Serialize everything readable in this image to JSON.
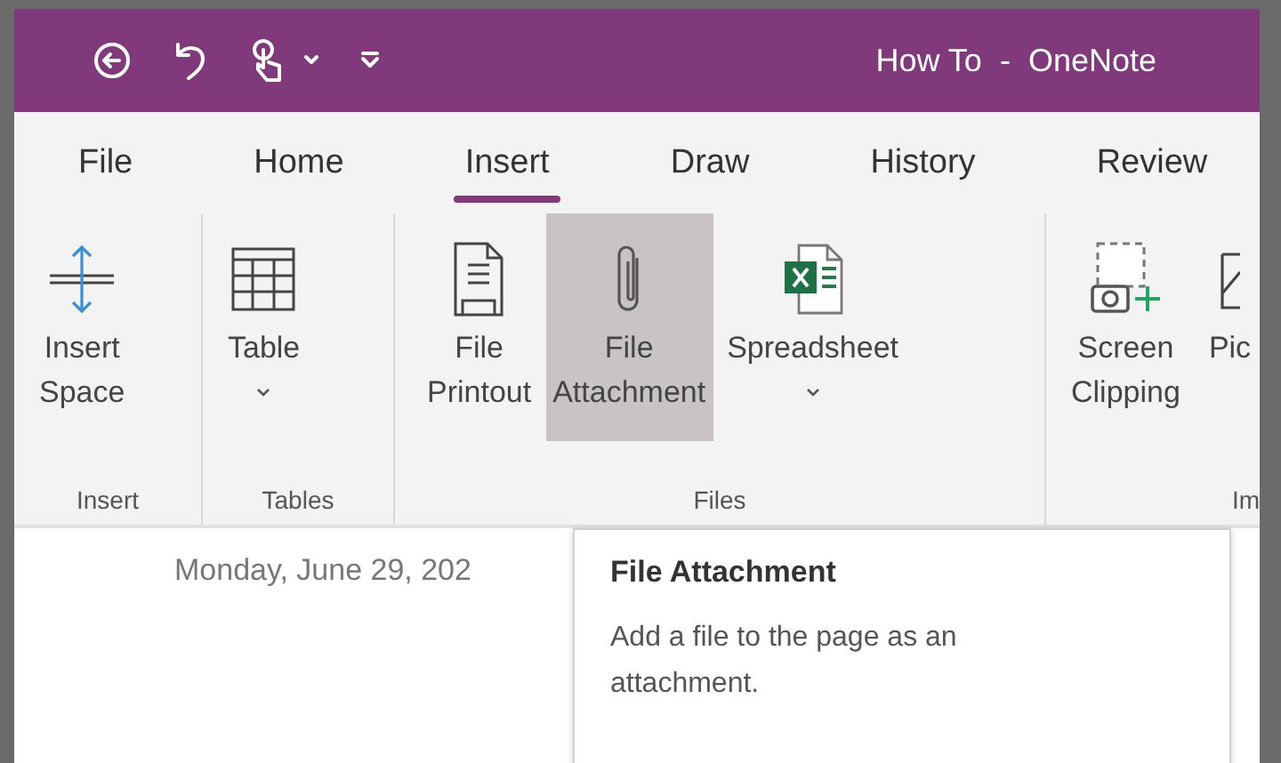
{
  "window": {
    "title": "How To  -  OneNote"
  },
  "tabs": [
    {
      "label": "File",
      "selected": false
    },
    {
      "label": "Home",
      "selected": false
    },
    {
      "label": "Insert",
      "selected": true
    },
    {
      "label": "Draw",
      "selected": false
    },
    {
      "label": "History",
      "selected": false
    },
    {
      "label": "Review",
      "selected": false
    }
  ],
  "ribbon": {
    "groups": [
      {
        "label": "Insert",
        "buttons": [
          {
            "lines": [
              "Insert",
              "Space"
            ],
            "dropdown": false,
            "hovered": false
          }
        ]
      },
      {
        "label": "Tables",
        "buttons": [
          {
            "lines": [
              "Table"
            ],
            "dropdown": true,
            "hovered": false
          }
        ]
      },
      {
        "label": "Files",
        "buttons": [
          {
            "lines": [
              "File",
              "Printout"
            ],
            "dropdown": false,
            "hovered": false
          },
          {
            "lines": [
              "File",
              "Attachment"
            ],
            "dropdown": false,
            "hovered": true
          },
          {
            "lines": [
              "Spreadsheet"
            ],
            "dropdown": true,
            "hovered": false
          }
        ]
      },
      {
        "label": "Im",
        "buttons": [
          {
            "lines": [
              "Screen",
              "Clipping"
            ],
            "dropdown": false,
            "hovered": false
          },
          {
            "lines": [
              "Pic"
            ],
            "dropdown": false,
            "hovered": false
          }
        ]
      }
    ]
  },
  "page": {
    "date": "Monday, June 29, 202"
  },
  "tooltip": {
    "title": "File Attachment",
    "text": "Add a file to the page as an attachment."
  }
}
